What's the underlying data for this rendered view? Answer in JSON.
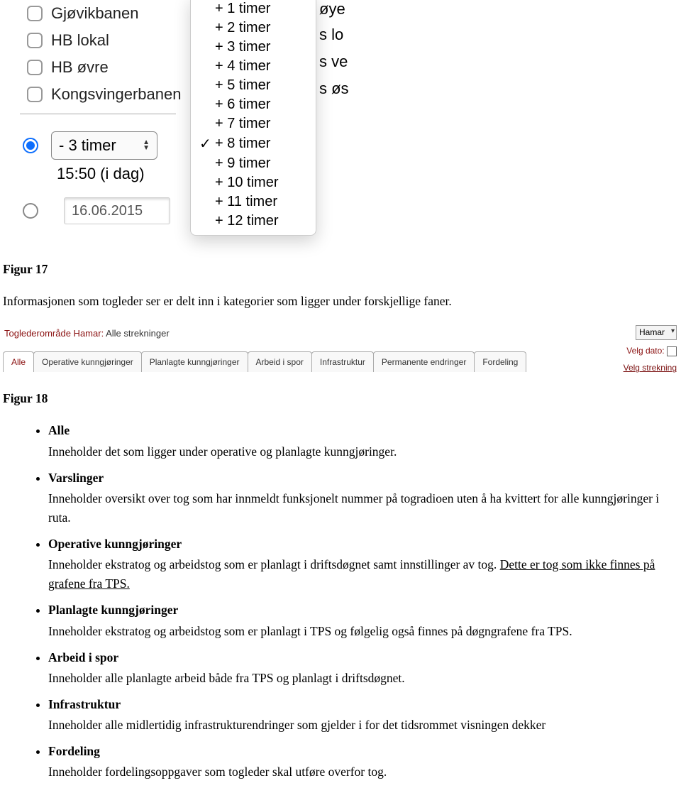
{
  "checkboxes": {
    "items": [
      "Gjøvikbanen",
      "HB lokal",
      "HB øvre",
      "Kongsvingerbanen"
    ]
  },
  "time_select": {
    "selected": "- 3 timer",
    "sub_label": "15:50 (i dag)"
  },
  "date_input": {
    "value": "16.06.2015"
  },
  "dropdown": {
    "items": [
      "+ 1 timer",
      "+ 2 timer",
      "+ 3 timer",
      "+ 4 timer",
      "+ 5 timer",
      "+ 6 timer",
      "+ 7 timer",
      "+ 8 timer",
      "+ 9 timer",
      "+ 10 timer",
      "+ 11 timer",
      "+ 12 timer"
    ],
    "checked_index": 7
  },
  "partial_right": [
    "øye",
    "s lo",
    "s ve",
    "s øs"
  ],
  "figure_captions": {
    "f17": "Figur 17",
    "f18": "Figur 18"
  },
  "intro_para": "Informasjonen som togleder ser er delt inn i kategorier som ligger under forskjellige faner.",
  "tabs_shot": {
    "title_label": "Toglederområde Hamar:",
    "title_value": "Alle strekninger",
    "right_area_select": "Hamar",
    "right_date_label": "Velg dato:",
    "right_link": "Velg strekning",
    "tabs": [
      "Alle",
      "Operative kunngjøringer",
      "Planlagte kunngjøringer",
      "Arbeid i spor",
      "Infrastruktur",
      "Permanente endringer",
      "Fordeling"
    ]
  },
  "bullets": [
    {
      "term": "Alle",
      "desc": "Inneholder det som ligger under operative og planlagte kunngjøringer."
    },
    {
      "term": "Varslinger",
      "desc": "Inneholder oversikt over tog som har innmeldt funksjonelt nummer på togradioen uten å ha kvittert for alle kunngjøringer i ruta."
    },
    {
      "term": "Operative kunngjøringer",
      "desc_pre": "Inneholder ekstratog og arbeidstog som er planlagt i driftsdøgnet samt innstillinger av tog. ",
      "desc_u": "Dette er tog som ikke finnes på grafene fra TPS."
    },
    {
      "term": "Planlagte kunngjøringer",
      "desc": "Inneholder ekstratog og arbeidstog som er planlagt i TPS og følgelig også finnes på døgngrafene fra TPS."
    },
    {
      "term": "Arbeid i spor",
      "desc": "Inneholder alle planlagte arbeid både fra TPS og planlagt i driftsdøgnet."
    },
    {
      "term": "Infrastruktur",
      "desc": "Inneholder alle midlertidig infrastrukturendringer som gjelder i for det tidsrommet visningen dekker"
    },
    {
      "term": "Fordeling",
      "desc": "Inneholder fordelingsoppgaver som togleder skal utføre overfor tog."
    }
  ]
}
